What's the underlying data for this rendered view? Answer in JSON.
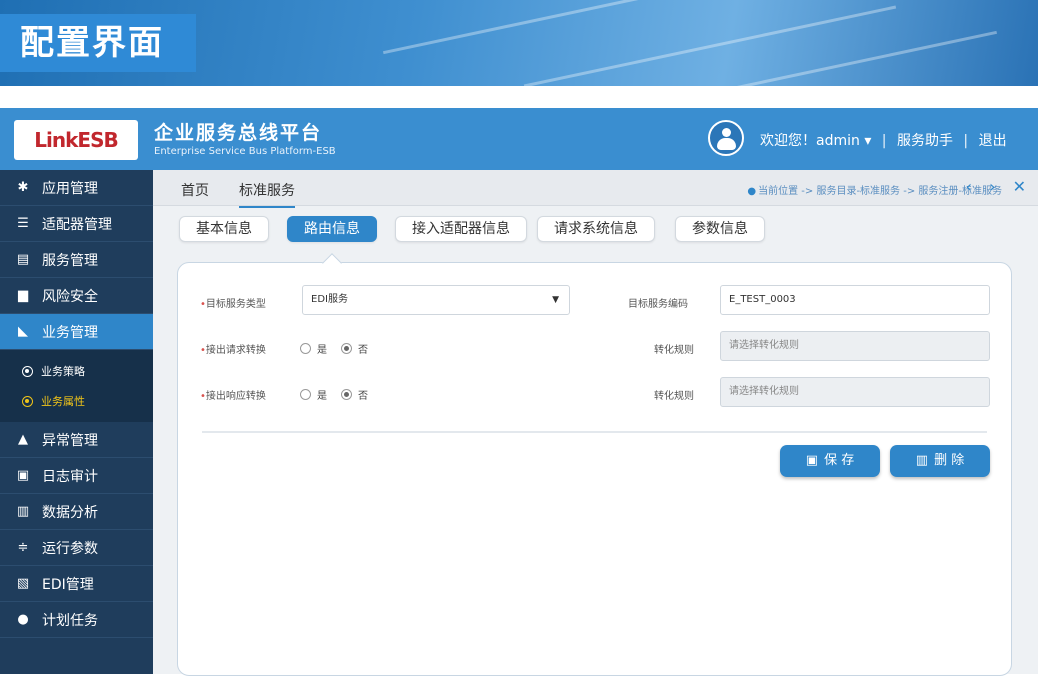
{
  "banner": {
    "title": "配置界面"
  },
  "header": {
    "logo_text": "LinkESB",
    "platform_name": "企业服务总线平台",
    "platform_sub": "Enterprise Service Bus Platform-ESB",
    "welcome": "欢迎您！admin ▾",
    "sep": "|",
    "help": "服务助手",
    "logout": "退出"
  },
  "sidebar": {
    "items": [
      {
        "label": "应用管理",
        "icon": "gear-icon"
      },
      {
        "label": "适配器管理",
        "icon": "list-icon"
      },
      {
        "label": "服务管理",
        "icon": "server-icon"
      },
      {
        "label": "风险安全",
        "icon": "briefcase-icon"
      },
      {
        "label": "业务管理",
        "icon": "rss-icon"
      },
      {
        "label": "异常管理",
        "icon": "warning-icon"
      },
      {
        "label": "日志审计",
        "icon": "log-icon"
      },
      {
        "label": "数据分析",
        "icon": "bar-chart-icon"
      },
      {
        "label": "运行参数",
        "icon": "sliders-icon"
      },
      {
        "label": "EDI管理",
        "icon": "edi-icon"
      },
      {
        "label": "计划任务",
        "icon": "user-icon"
      }
    ],
    "sub_items": [
      {
        "label": "业务策略"
      },
      {
        "label": "业务属性"
      }
    ]
  },
  "crumb": {
    "home": "首页",
    "current": "标准服务",
    "location": "当前位置 -> 服务目录-标准服务 -> 服务注册-标准服务",
    "nav": "‹ › ✕"
  },
  "tabs": [
    "基本信息",
    "路由信息",
    "接入适配器信息",
    "请求系统信息",
    "参数信息"
  ],
  "form": {
    "target_type_label": "目标服务类型",
    "target_type_value": "EDI服务",
    "target_code_label": "目标服务编码",
    "target_code_value": "E_TEST_0003",
    "req_convert_label": "接出请求转换",
    "resp_convert_label": "接出响应转换",
    "yes": "是",
    "no": "否",
    "rule_label": "转化规则",
    "rule_placeholder": "请选择转化规则",
    "required_mark": "•"
  },
  "actions": {
    "save": "保 存",
    "delete": "删 除"
  }
}
